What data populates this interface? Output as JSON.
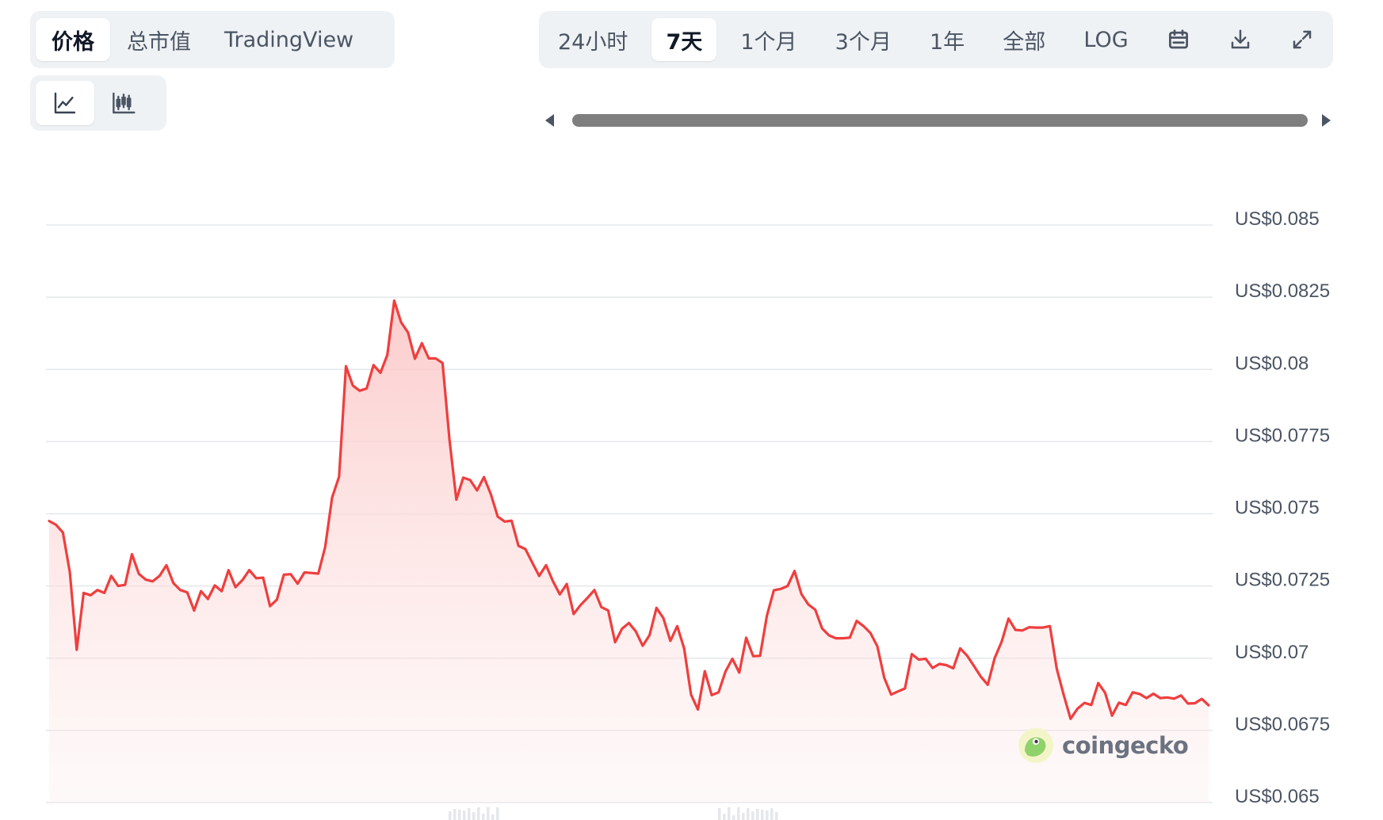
{
  "tabs_left": [
    {
      "label": "价格",
      "active": true
    },
    {
      "label": "总市值",
      "active": false
    },
    {
      "label": "TradingView",
      "active": false
    }
  ],
  "tabs_right": [
    {
      "label": "24小时",
      "active": false
    },
    {
      "label": "7天",
      "active": true
    },
    {
      "label": "1个月",
      "active": false
    },
    {
      "label": "3个月",
      "active": false
    },
    {
      "label": "1年",
      "active": false
    },
    {
      "label": "全部",
      "active": false
    },
    {
      "label": "LOG",
      "active": false
    }
  ],
  "toolbar_icons": [
    "calendar-icon",
    "download-icon",
    "fullscreen-icon"
  ],
  "chart_type_icons": [
    "line-chart-icon",
    "candlestick-chart-icon"
  ],
  "watermark": {
    "text": "coingecko"
  },
  "colors": {
    "line": "#ef3e3e",
    "fill_top": "#fcc9c9",
    "accent_bg": "#eff2f5"
  },
  "chart_data": {
    "type": "area",
    "title": "",
    "xlabel": "",
    "ylabel": "",
    "ylim": [
      0.065,
      0.085
    ],
    "y_tick_values": [
      0.085,
      0.0825,
      0.08,
      0.0775,
      0.075,
      0.0725,
      0.07,
      0.0675,
      0.065
    ],
    "y_tick_labels": [
      "US$0.085",
      "US$0.0825",
      "US$0.08",
      "US$0.0775",
      "US$0.075",
      "US$0.0725",
      "US$0.07",
      "US$0.0675",
      "US$0.065"
    ],
    "grid": true,
    "series": [
      {
        "values": [
          0.07475,
          0.07462,
          0.07435,
          0.07298,
          0.07029,
          0.07226,
          0.07218,
          0.07236,
          0.07226,
          0.07285,
          0.0725,
          0.07254,
          0.0736,
          0.07292,
          0.07272,
          0.07266,
          0.07285,
          0.07322,
          0.0726,
          0.07236,
          0.07228,
          0.07165,
          0.07232,
          0.07205,
          0.07252,
          0.07232,
          0.07305,
          0.07246,
          0.0727,
          0.07305,
          0.07277,
          0.07279,
          0.0718,
          0.07203,
          0.07289,
          0.07291,
          0.07258,
          0.07297,
          0.07295,
          0.07293,
          0.07385,
          0.07556,
          0.07628,
          0.08011,
          0.07944,
          0.07926,
          0.07934,
          0.08015,
          0.07988,
          0.0805,
          0.08238,
          0.08163,
          0.08128,
          0.08037,
          0.08091,
          0.08038,
          0.08038,
          0.08022,
          0.07758,
          0.07549,
          0.07625,
          0.07617,
          0.07581,
          0.07627,
          0.07568,
          0.0749,
          0.07473,
          0.07476,
          0.07389,
          0.07378,
          0.07331,
          0.07285,
          0.07322,
          0.07266,
          0.07221,
          0.07257,
          0.07153,
          0.07184,
          0.07209,
          0.07236,
          0.07177,
          0.07165,
          0.07055,
          0.07102,
          0.07122,
          0.07093,
          0.07043,
          0.0708,
          0.07174,
          0.07139,
          0.0706,
          0.07111,
          0.07034,
          0.06874,
          0.06822,
          0.06955,
          0.06872,
          0.06882,
          0.06954,
          0.06998,
          0.0695,
          0.07071,
          0.07007,
          0.07008,
          0.07148,
          0.07235,
          0.0724,
          0.0725,
          0.07302,
          0.07222,
          0.07186,
          0.07168,
          0.07103,
          0.07079,
          0.07069,
          0.07069,
          0.07071,
          0.07129,
          0.07111,
          0.07087,
          0.07041,
          0.06932,
          0.06874,
          0.06885,
          0.06895,
          0.07014,
          0.06995,
          0.06998,
          0.06966,
          0.0698,
          0.06976,
          0.06965,
          0.07034,
          0.07009,
          0.06973,
          0.06936,
          0.06908,
          0.07,
          0.07057,
          0.07137,
          0.07098,
          0.07096,
          0.07107,
          0.07106,
          0.07106,
          0.07111,
          0.06963,
          0.06873,
          0.0679,
          0.06825,
          0.06845,
          0.06838,
          0.06914,
          0.0688,
          0.06801,
          0.06846,
          0.06838,
          0.06882,
          0.06876,
          0.06862,
          0.06877,
          0.06862,
          0.06864,
          0.0686,
          0.06871,
          0.06843,
          0.06844,
          0.06859,
          0.06837
        ]
      }
    ]
  }
}
